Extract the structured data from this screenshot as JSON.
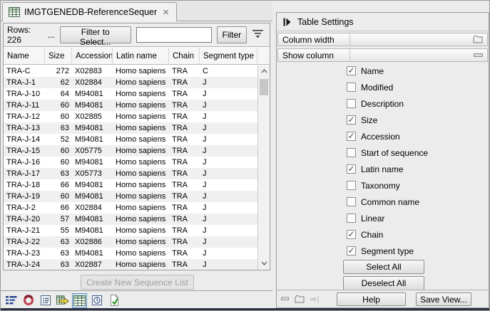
{
  "tab": {
    "title": "IMGTGENEDB-ReferenceSequences...",
    "icon": "table-icon",
    "close_icon": "close-icon"
  },
  "toolbar": {
    "rows_label": "Rows: 226",
    "ellipsis": "...",
    "filter_to_select_label": "Filter to Select...",
    "filter_input_value": "",
    "filter_label": "Filter",
    "advanced_filter_icon": "filter-dropdown-icon"
  },
  "table": {
    "columns": [
      "Name",
      "Size",
      "Accession",
      "Latin name",
      "Chain",
      "Segment type"
    ],
    "rows": [
      {
        "name": "TRA-C",
        "size": 272,
        "accession": "X02883",
        "latin_name": "Homo sapiens",
        "chain": "TRA",
        "segment_type": "C"
      },
      {
        "name": "TRA-J-1",
        "size": 62,
        "accession": "X02884",
        "latin_name": "Homo sapiens",
        "chain": "TRA",
        "segment_type": "J"
      },
      {
        "name": "TRA-J-10",
        "size": 64,
        "accession": "M94081",
        "latin_name": "Homo sapiens",
        "chain": "TRA",
        "segment_type": "J"
      },
      {
        "name": "TRA-J-11",
        "size": 60,
        "accession": "M94081",
        "latin_name": "Homo sapiens",
        "chain": "TRA",
        "segment_type": "J"
      },
      {
        "name": "TRA-J-12",
        "size": 60,
        "accession": "X02885",
        "latin_name": "Homo sapiens",
        "chain": "TRA",
        "segment_type": "J"
      },
      {
        "name": "TRA-J-13",
        "size": 63,
        "accession": "M94081",
        "latin_name": "Homo sapiens",
        "chain": "TRA",
        "segment_type": "J"
      },
      {
        "name": "TRA-J-14",
        "size": 52,
        "accession": "M94081",
        "latin_name": "Homo sapiens",
        "chain": "TRA",
        "segment_type": "J"
      },
      {
        "name": "TRA-J-15",
        "size": 60,
        "accession": "X05775",
        "latin_name": "Homo sapiens",
        "chain": "TRA",
        "segment_type": "J"
      },
      {
        "name": "TRA-J-16",
        "size": 60,
        "accession": "M94081",
        "latin_name": "Homo sapiens",
        "chain": "TRA",
        "segment_type": "J"
      },
      {
        "name": "TRA-J-17",
        "size": 63,
        "accession": "X05773",
        "latin_name": "Homo sapiens",
        "chain": "TRA",
        "segment_type": "J"
      },
      {
        "name": "TRA-J-18",
        "size": 66,
        "accession": "M94081",
        "latin_name": "Homo sapiens",
        "chain": "TRA",
        "segment_type": "J"
      },
      {
        "name": "TRA-J-19",
        "size": 60,
        "accession": "M94081",
        "latin_name": "Homo sapiens",
        "chain": "TRA",
        "segment_type": "J"
      },
      {
        "name": "TRA-J-2",
        "size": 66,
        "accession": "X02884",
        "latin_name": "Homo sapiens",
        "chain": "TRA",
        "segment_type": "J"
      },
      {
        "name": "TRA-J-20",
        "size": 57,
        "accession": "M94081",
        "latin_name": "Homo sapiens",
        "chain": "TRA",
        "segment_type": "J"
      },
      {
        "name": "TRA-J-21",
        "size": 55,
        "accession": "M94081",
        "latin_name": "Homo sapiens",
        "chain": "TRA",
        "segment_type": "J"
      },
      {
        "name": "TRA-J-22",
        "size": 63,
        "accession": "X02886",
        "latin_name": "Homo sapiens",
        "chain": "TRA",
        "segment_type": "J"
      },
      {
        "name": "TRA-J-23",
        "size": 63,
        "accession": "M94081",
        "latin_name": "Homo sapiens",
        "chain": "TRA",
        "segment_type": "J"
      },
      {
        "name": "TRA-J-24",
        "size": 63,
        "accession": "X02887",
        "latin_name": "Homo sapiens",
        "chain": "TRA",
        "segment_type": "J"
      }
    ]
  },
  "create_button_label": "Create New Sequence List",
  "view_bar": {
    "icons": [
      "list-view-icon",
      "circular-view-icon",
      "text-view-icon",
      "table-export-icon",
      "table-view-icon",
      "history-view-icon",
      "element-info-icon"
    ],
    "selected": "table-view-icon"
  },
  "settings": {
    "title": "Table Settings",
    "column_width_label": "Column width",
    "column_width_icon": "folder-icon",
    "show_column_label": "Show column",
    "show_column_icon": "collapse-icon",
    "options": [
      {
        "label": "Name",
        "checked": true
      },
      {
        "label": "Modified",
        "checked": false
      },
      {
        "label": "Description",
        "checked": false
      },
      {
        "label": "Size",
        "checked": true
      },
      {
        "label": "Accession",
        "checked": true
      },
      {
        "label": "Start of sequence",
        "checked": false
      },
      {
        "label": "Latin name",
        "checked": true
      },
      {
        "label": "Taxonomy",
        "checked": false
      },
      {
        "label": "Common name",
        "checked": false
      },
      {
        "label": "Linear",
        "checked": false
      },
      {
        "label": "Chain",
        "checked": true
      },
      {
        "label": "Segment type",
        "checked": true
      }
    ],
    "select_all_label": "Select All",
    "deselect_all_label": "Deselect All"
  },
  "settings_footer": {
    "icons": [
      "collapse-icon",
      "folder-icon",
      "dock-icon"
    ],
    "help_label": "Help",
    "save_view_label": "Save View..."
  },
  "colors": {
    "selection_accent": "#5a8fc0",
    "row_stripe": "#f0f0f0"
  }
}
